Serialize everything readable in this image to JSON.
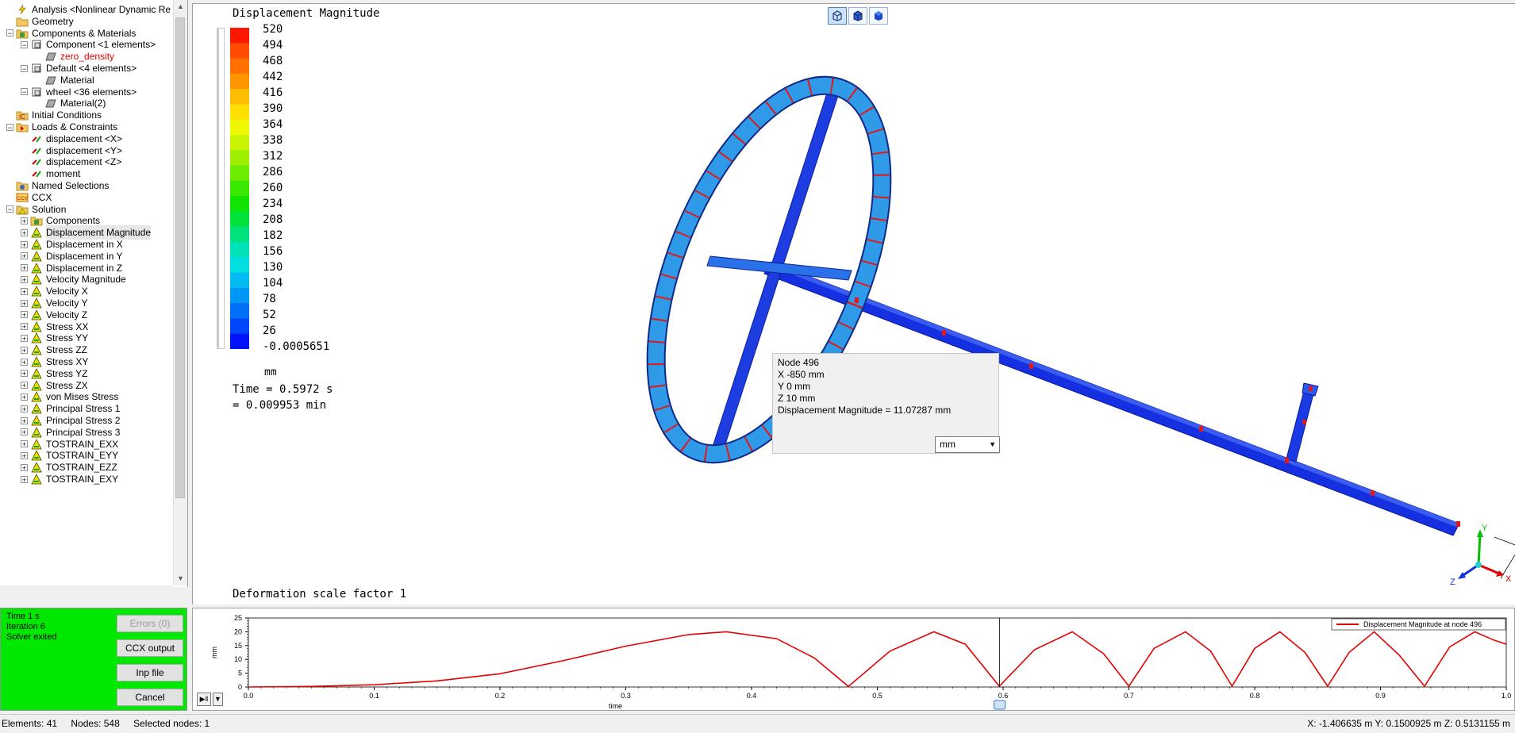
{
  "tree": {
    "items": [
      {
        "label": "Analysis <Nonlinear Dynamic Re",
        "level": 1,
        "icon": "lightning-icon",
        "expander": ""
      },
      {
        "label": "Geometry",
        "level": 1,
        "icon": "folder-icon",
        "expander": ""
      },
      {
        "label": "Components & Materials",
        "level": 1,
        "icon": "components-icon",
        "expander": "−"
      },
      {
        "label": "Component <1 elements>",
        "level": 2,
        "icon": "component-icon",
        "expander": "−"
      },
      {
        "label": "zero_density",
        "level": 3,
        "icon": "material-icon",
        "expander": "",
        "red": true
      },
      {
        "label": "Default <4 elements>",
        "level": 2,
        "icon": "component-icon",
        "expander": "−"
      },
      {
        "label": "Material",
        "level": 3,
        "icon": "material-icon",
        "expander": ""
      },
      {
        "label": "wheel <36 elements>",
        "level": 2,
        "icon": "component-icon",
        "expander": "−"
      },
      {
        "label": "Material(2)",
        "level": 3,
        "icon": "material-icon",
        "expander": ""
      },
      {
        "label": "Initial Conditions",
        "level": 1,
        "icon": "initial-conditions-icon",
        "expander": ""
      },
      {
        "label": "Loads & Constraints",
        "level": 1,
        "icon": "loads-folder-icon",
        "expander": "−"
      },
      {
        "label": "displacement <X>",
        "level": 2,
        "icon": "constraint-icon",
        "expander": ""
      },
      {
        "label": "displacement <Y>",
        "level": 2,
        "icon": "constraint-icon",
        "expander": ""
      },
      {
        "label": "displacement <Z>",
        "level": 2,
        "icon": "constraint-icon",
        "expander": ""
      },
      {
        "label": "moment",
        "level": 2,
        "icon": "constraint-icon",
        "expander": ""
      },
      {
        "label": "Named Selections",
        "level": 1,
        "icon": "named-selections-icon",
        "expander": ""
      },
      {
        "label": "CCX",
        "level": 1,
        "icon": "ccx-icon",
        "expander": ""
      },
      {
        "label": "Solution",
        "level": 1,
        "icon": "solution-icon",
        "expander": "−"
      },
      {
        "label": "Components",
        "level": 2,
        "icon": "components-icon",
        "expander": "+"
      },
      {
        "label": "Displacement Magnitude",
        "level": 2,
        "icon": "result-icon",
        "expander": "+",
        "selected": true
      },
      {
        "label": "Displacement in X",
        "level": 2,
        "icon": "result-icon",
        "expander": "+"
      },
      {
        "label": "Displacement in Y",
        "level": 2,
        "icon": "result-icon",
        "expander": "+"
      },
      {
        "label": "Displacement in Z",
        "level": 2,
        "icon": "result-icon",
        "expander": "+"
      },
      {
        "label": "Velocity Magnitude",
        "level": 2,
        "icon": "result-icon",
        "expander": "+"
      },
      {
        "label": "Velocity X",
        "level": 2,
        "icon": "result-icon",
        "expander": "+"
      },
      {
        "label": "Velocity Y",
        "level": 2,
        "icon": "result-icon",
        "expander": "+"
      },
      {
        "label": "Velocity Z",
        "level": 2,
        "icon": "result-icon",
        "expander": "+"
      },
      {
        "label": "Stress XX",
        "level": 2,
        "icon": "result-icon",
        "expander": "+"
      },
      {
        "label": "Stress YY",
        "level": 2,
        "icon": "result-icon",
        "expander": "+"
      },
      {
        "label": "Stress ZZ",
        "level": 2,
        "icon": "result-icon",
        "expander": "+"
      },
      {
        "label": "Stress XY",
        "level": 2,
        "icon": "result-icon",
        "expander": "+"
      },
      {
        "label": "Stress YZ",
        "level": 2,
        "icon": "result-icon",
        "expander": "+"
      },
      {
        "label": "Stress ZX",
        "level": 2,
        "icon": "result-icon",
        "expander": "+"
      },
      {
        "label": "von Mises Stress",
        "level": 2,
        "icon": "result-icon",
        "expander": "+"
      },
      {
        "label": "Principal Stress 1",
        "level": 2,
        "icon": "result-icon",
        "expander": "+"
      },
      {
        "label": "Principal Stress 2",
        "level": 2,
        "icon": "result-icon",
        "expander": "+"
      },
      {
        "label": "Principal Stress 3",
        "level": 2,
        "icon": "result-icon",
        "expander": "+"
      },
      {
        "label": "TOSTRAIN_EXX",
        "level": 2,
        "icon": "result-icon",
        "expander": "+"
      },
      {
        "label": "TOSTRAIN_EYY",
        "level": 2,
        "icon": "result-icon",
        "expander": "+"
      },
      {
        "label": "TOSTRAIN_EZZ",
        "level": 2,
        "icon": "result-icon",
        "expander": "+"
      },
      {
        "label": "TOSTRAIN_EXY",
        "level": 2,
        "icon": "result-icon",
        "expander": "+"
      }
    ]
  },
  "viewport": {
    "title": "Displacement Magnitude",
    "legend_values": [
      "520",
      "494",
      "468",
      "442",
      "416",
      "390",
      "364",
      "338",
      "312",
      "286",
      "260",
      "234",
      "208",
      "182",
      "156",
      "130",
      "104",
      "78",
      "52",
      "26",
      "-0.0005651"
    ],
    "legend_colors": [
      "#ff1800",
      "#ff4c00",
      "#ff7000",
      "#ff9600",
      "#ffbd00",
      "#ffe000",
      "#eef800",
      "#c8f400",
      "#9cf000",
      "#6cec00",
      "#3ae800",
      "#10e400",
      "#00e23a",
      "#00e27c",
      "#00e2b8",
      "#00e0e0",
      "#00bcf2",
      "#0096f6",
      "#0070f8",
      "#0046fa",
      "#0014fc"
    ],
    "unit": "mm",
    "time_line1": "Time = 0.5972 s",
    "time_line2": "= 0.009953 min",
    "deformation": "Deformation scale factor 1",
    "view_buttons": [
      "wireframe-view-icon",
      "shaded-edges-view-icon",
      "shaded-view-icon"
    ]
  },
  "node_info": {
    "lines": [
      "Node  496",
      "X  -850 mm",
      "Y  0 mm",
      "Z  10 mm",
      "Displacement Magnitude = 11.07287 mm"
    ],
    "unit_select": "mm"
  },
  "solver_panel": {
    "color": "#00e800",
    "lines": [
      "Time 1 s",
      "Iteration 6",
      "Solver exited"
    ],
    "buttons": {
      "errors": "Errors (0)",
      "ccx": "CCX output",
      "inp": "Inp file",
      "cancel": "Cancel"
    }
  },
  "status_bar": {
    "elements": "Elements: 41",
    "nodes": "Nodes: 548",
    "selected": "Selected nodes: 1",
    "coords": "X: -1.406635 m Y: 0.1500925 m Z: 0.5131155 m"
  },
  "chart_data": {
    "type": "line",
    "xlabel": "time",
    "ylabel": "mm",
    "xlim": [
      0,
      1
    ],
    "ylim": [
      0,
      25
    ],
    "xticks": [
      "0.0",
      "0.1",
      "0.2",
      "0.3",
      "0.4",
      "0.5",
      "0.6",
      "0.7",
      "0.8",
      "0.9",
      "1.0"
    ],
    "yticks": [
      "0",
      "5",
      "10",
      "15",
      "20",
      "25"
    ],
    "cursor_x": 0.5972,
    "series": [
      {
        "name": "Displacement Magnitude at node 496",
        "color": "#e60000",
        "x": [
          0.0,
          0.05,
          0.1,
          0.15,
          0.2,
          0.25,
          0.3,
          0.35,
          0.38,
          0.42,
          0.45,
          0.477,
          0.51,
          0.545,
          0.57,
          0.597,
          0.625,
          0.655,
          0.68,
          0.7,
          0.72,
          0.745,
          0.765,
          0.782,
          0.8,
          0.82,
          0.84,
          0.858,
          0.875,
          0.895,
          0.915,
          0.935,
          0.955,
          0.975,
          0.99,
          1.0
        ],
        "y": [
          0.0,
          0.2,
          0.8,
          2.2,
          4.8,
          9.5,
          14.8,
          19.0,
          20.0,
          17.5,
          10.5,
          0.2,
          13.0,
          20.0,
          15.5,
          0.3,
          13.5,
          20.0,
          12.0,
          0.3,
          14.0,
          20.0,
          13.0,
          0.3,
          14.0,
          20.0,
          12.5,
          0.3,
          12.5,
          20.0,
          11.5,
          0.3,
          14.5,
          20.0,
          17.0,
          15.5
        ]
      }
    ]
  }
}
